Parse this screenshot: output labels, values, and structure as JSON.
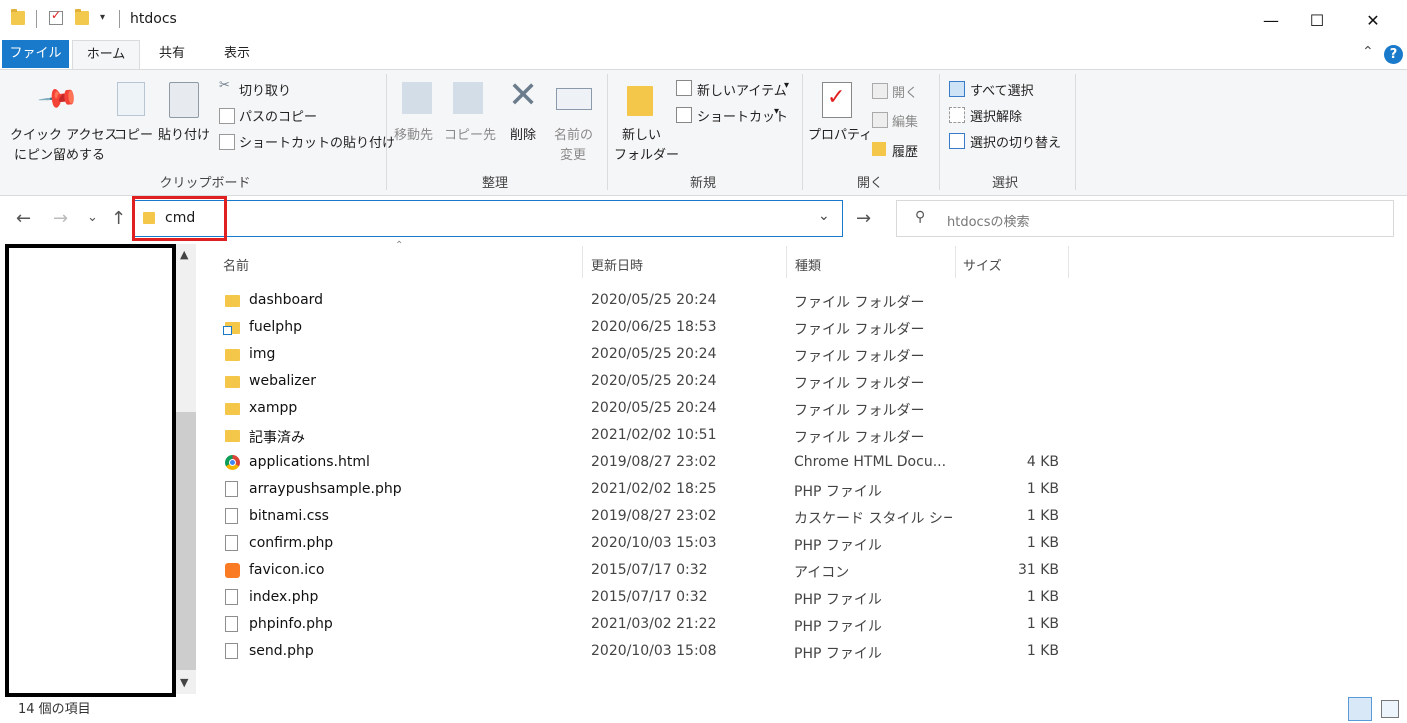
{
  "window": {
    "title": "htdocs",
    "minimize": "—",
    "maximize": "☐",
    "close": "✕"
  },
  "tabs": [
    "ファイル",
    "ホーム",
    "共有",
    "表示"
  ],
  "ribbon": {
    "clipboard": {
      "pin_label_1": "クイック アクセス",
      "pin_label_2": "にピン留めする",
      "copy": "コピー",
      "paste": "貼り付け",
      "cut": "切り取り",
      "copy_path": "パスのコピー",
      "paste_shortcut": "ショートカットの貼り付け",
      "group": "クリップボード"
    },
    "organize": {
      "move_to": "移動先",
      "copy_to": "コピー先",
      "delete": "削除",
      "rename_1": "名前の",
      "rename_2": "変更",
      "group": "整理"
    },
    "new": {
      "new_folder_1": "新しい",
      "new_folder_2": "フォルダー",
      "new_item": "新しいアイテム",
      "shortcut": "ショートカット",
      "group": "新規"
    },
    "open": {
      "properties": "プロパティ",
      "open": "開く",
      "edit": "編集",
      "history": "履歴",
      "group": "開く"
    },
    "select": {
      "select_all": "すべて選択",
      "select_none": "選択解除",
      "invert": "選択の切り替え",
      "group": "選択"
    }
  },
  "address": {
    "value": "cmd",
    "search_placeholder": "htdocsの検索"
  },
  "columns": [
    "名前",
    "更新日時",
    "種類",
    "サイズ"
  ],
  "files": [
    {
      "name": "dashboard",
      "date": "2020/05/25 20:24",
      "type": "ファイル フォルダー",
      "size": "",
      "icon": "folder"
    },
    {
      "name": "fuelphp",
      "date": "2020/06/25 18:53",
      "type": "ファイル フォルダー",
      "size": "",
      "icon": "folder-shortcut"
    },
    {
      "name": "img",
      "date": "2020/05/25 20:24",
      "type": "ファイル フォルダー",
      "size": "",
      "icon": "folder"
    },
    {
      "name": "webalizer",
      "date": "2020/05/25 20:24",
      "type": "ファイル フォルダー",
      "size": "",
      "icon": "folder"
    },
    {
      "name": "xampp",
      "date": "2020/05/25 20:24",
      "type": "ファイル フォルダー",
      "size": "",
      "icon": "folder"
    },
    {
      "name": "記事済み",
      "date": "2021/02/02 10:51",
      "type": "ファイル フォルダー",
      "size": "",
      "icon": "folder"
    },
    {
      "name": "applications.html",
      "date": "2019/08/27 23:02",
      "type": "Chrome HTML Docu...",
      "size": "4 KB",
      "icon": "chrome"
    },
    {
      "name": "arraypushsample.php",
      "date": "2021/02/02 18:25",
      "type": "PHP ファイル",
      "size": "1 KB",
      "icon": "file"
    },
    {
      "name": "bitnami.css",
      "date": "2019/08/27 23:02",
      "type": "カスケード スタイル シート ...",
      "size": "1 KB",
      "icon": "file"
    },
    {
      "name": "confirm.php",
      "date": "2020/10/03 15:03",
      "type": "PHP ファイル",
      "size": "1 KB",
      "icon": "file"
    },
    {
      "name": "favicon.ico",
      "date": "2015/07/17 0:32",
      "type": "アイコン",
      "size": "31 KB",
      "icon": "xampp"
    },
    {
      "name": "index.php",
      "date": "2015/07/17 0:32",
      "type": "PHP ファイル",
      "size": "1 KB",
      "icon": "file"
    },
    {
      "name": "phpinfo.php",
      "date": "2021/03/02 21:22",
      "type": "PHP ファイル",
      "size": "1 KB",
      "icon": "file"
    },
    {
      "name": "send.php",
      "date": "2020/10/03 15:08",
      "type": "PHP ファイル",
      "size": "1 KB",
      "icon": "file"
    }
  ],
  "status": {
    "count": "14 個の項目"
  },
  "colors": {
    "accent": "#1979ca",
    "highlight": "#e02020"
  }
}
